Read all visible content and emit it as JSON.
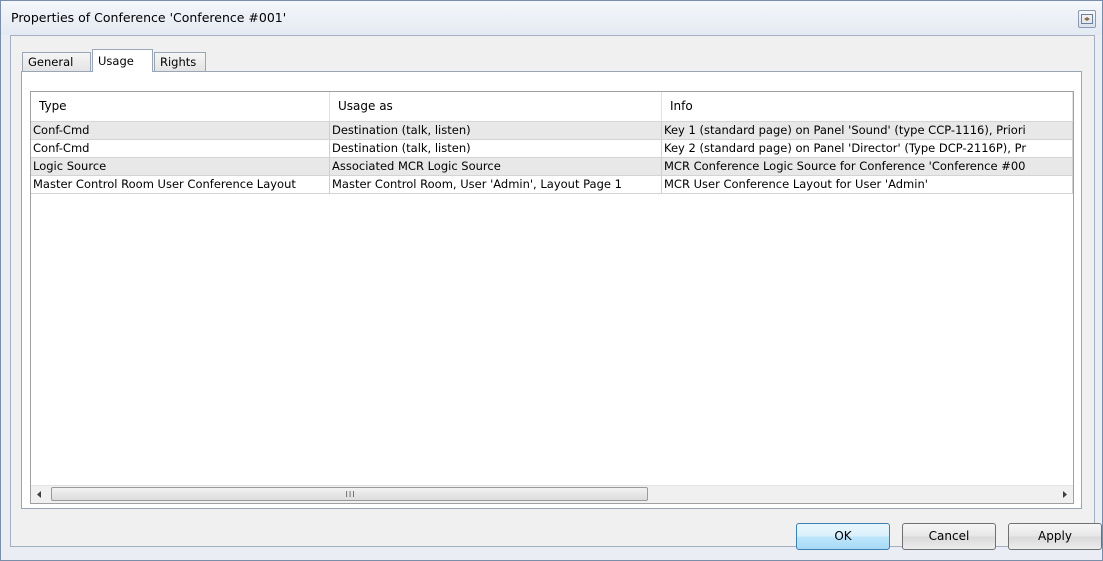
{
  "window": {
    "title": "Properties of Conference 'Conference #001'"
  },
  "tabs": [
    {
      "label": "General",
      "active": false
    },
    {
      "label": "Usage",
      "active": true
    },
    {
      "label": "Rights",
      "active": false
    }
  ],
  "usage_table": {
    "columns": [
      "Type",
      "Usage as",
      "Info"
    ],
    "rows": [
      {
        "type": "Conf-Cmd",
        "usage_as": "Destination (talk, listen)",
        "info": "Key 1 (standard page) on Panel 'Sound' (type CCP-1116), Priori"
      },
      {
        "type": "Conf-Cmd",
        "usage_as": "Destination (talk, listen)",
        "info": "Key 2 (standard page) on Panel 'Director' (Type DCP-2116P), Pr"
      },
      {
        "type": "Logic Source",
        "usage_as": "Associated MCR Logic Source",
        "info": "MCR Conference Logic Source for Conference 'Conference #00"
      },
      {
        "type": "Master Control Room User Conference Layout",
        "usage_as": "Master Control Room, User 'Admin', Layout Page 1",
        "info": "MCR User Conference Layout for User 'Admin'"
      }
    ],
    "scrollbar": {
      "left_arrow": "◂",
      "right_arrow": "▸",
      "grip": "III"
    }
  },
  "buttons": {
    "ok": "OK",
    "cancel": "Cancel",
    "apply": "Apply"
  },
  "colors": {
    "row_shaded": "#e8e8e8",
    "default_button": "#bee6fd",
    "window_border": "#7a8ea9"
  }
}
